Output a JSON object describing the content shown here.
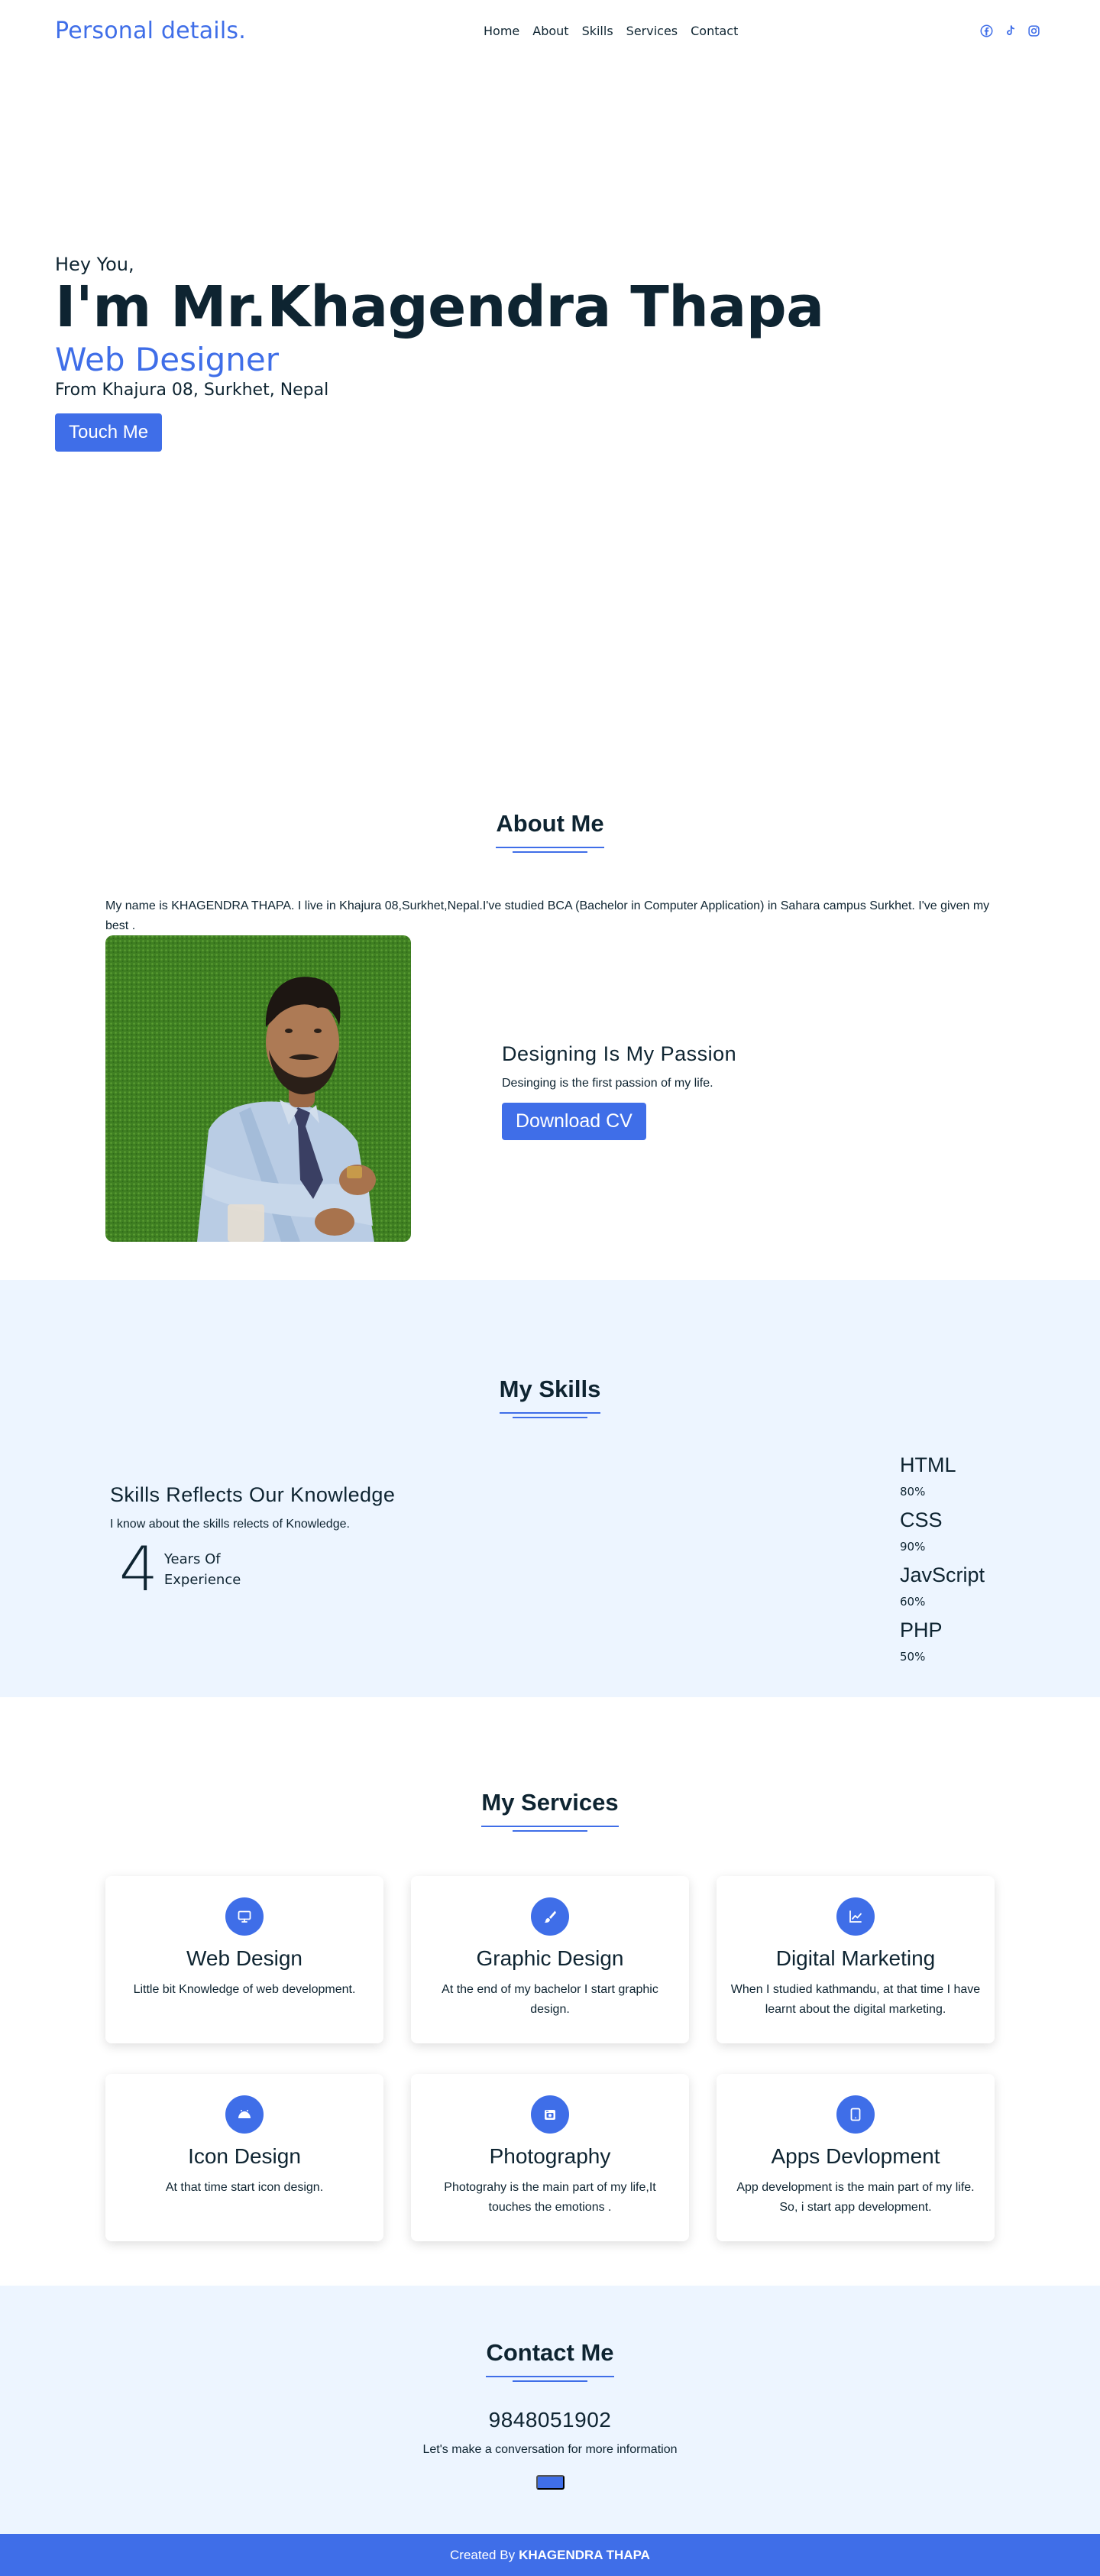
{
  "nav": {
    "brand": "Personal details.",
    "links": [
      "Home",
      "About",
      "Skills",
      "Services",
      "Contact"
    ],
    "social_icons": [
      "facebook-icon",
      "tiktok-icon",
      "instagram-icon"
    ]
  },
  "hero": {
    "greeting": "Hey You,",
    "name": "I'm Mr.Khagendra Thapa",
    "role": "Web Designer",
    "location": "From Khajura 08, Surkhet, Nepal",
    "button": "Touch Me"
  },
  "about": {
    "title": "About Me",
    "intro": "My name is KHAGENDRA THAPA. I live in Khajura 08,Surkhet,Nepal.I've studied BCA (Bachelor in Computer Application) in Sahara campus Surkhet. I've given my best .",
    "heading": "Designing Is My Passion",
    "text": "Desinging is the first passion of my life.",
    "button": "Download CV"
  },
  "skills": {
    "title": "My Skills",
    "heading": "Skills Reflects Our Knowledge",
    "text": "I know about the skills relects of Knowledge.",
    "experience_number": "4",
    "experience_label": "Years Of Experience",
    "items": [
      {
        "name": "HTML",
        "percent": "80%"
      },
      {
        "name": "CSS",
        "percent": "90%"
      },
      {
        "name": "JavScript",
        "percent": "60%"
      },
      {
        "name": "PHP",
        "percent": "50%"
      }
    ]
  },
  "services": {
    "title": "My Services",
    "items": [
      {
        "icon": "monitor-icon",
        "title": "Web Design",
        "text": "Little bit Knowledge of web development."
      },
      {
        "icon": "brush-icon",
        "title": "Graphic Design",
        "text": "At the end of my bachelor I start graphic design."
      },
      {
        "icon": "chart-icon",
        "title": "Digital Marketing",
        "text": "When I studied kathmandu, at that time I have learnt about the digital marketing."
      },
      {
        "icon": "cloud-icon",
        "title": "Icon Design",
        "text": "At that time start icon design."
      },
      {
        "icon": "camera-icon",
        "title": "Photography",
        "text": "Photograhy is the main part of my life,It touches the emotions ."
      },
      {
        "icon": "tablet-icon",
        "title": "Apps Devlopment",
        "text": "App development is the main part of my life. So, i start app development."
      }
    ]
  },
  "contact": {
    "title": "Contact Me",
    "phone": "9848051902",
    "note": "Let's make a conversation for more information"
  },
  "footer": {
    "prefix": "Created By",
    "author": "KHAGENDRA THAPA"
  },
  "colors": {
    "accent": "#3f6ee8",
    "text": "#0e2431",
    "section_bg": "#edf5ff"
  }
}
